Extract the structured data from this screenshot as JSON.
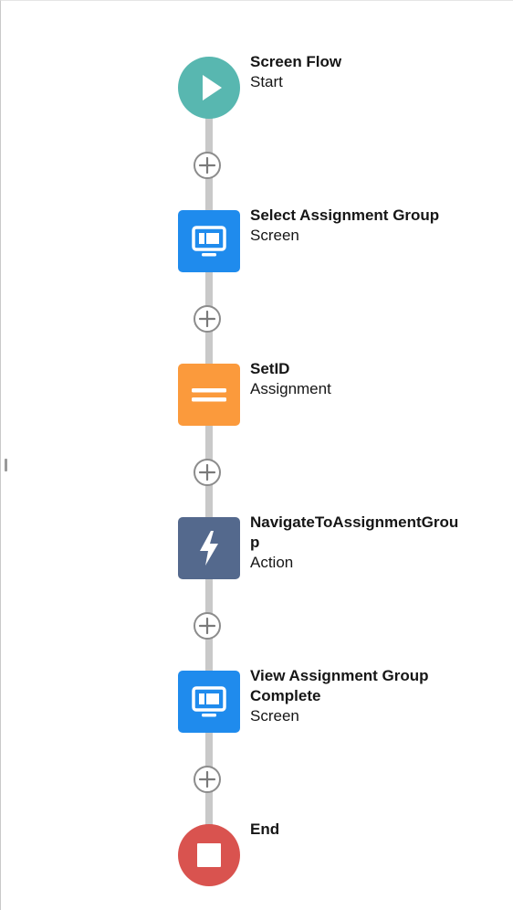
{
  "flow": {
    "elements": [
      {
        "title": "Screen Flow",
        "subtitle": "Start",
        "kind": "start",
        "color": "#58b7b0",
        "icon": "play-icon"
      },
      {
        "title": "Select Assignment Group",
        "subtitle": "Screen",
        "kind": "screen",
        "color": "#1f8bed",
        "icon": "screen-icon"
      },
      {
        "title": "SetID",
        "subtitle": "Assignment",
        "kind": "assignment",
        "color": "#fb9a3c",
        "icon": "equals-icon"
      },
      {
        "title": "NavigateToAssignmentGrou\np",
        "subtitle": "Action",
        "kind": "action",
        "color": "#54698d",
        "icon": "lightning-icon"
      },
      {
        "title": "View Assignment Group\nComplete",
        "subtitle": "Screen",
        "kind": "screen",
        "color": "#1f8bed",
        "icon": "screen-icon"
      },
      {
        "title": "End",
        "subtitle": "",
        "kind": "end",
        "color": "#d9534f",
        "icon": "stop-icon"
      }
    ],
    "add_button_icon": "plus-icon",
    "connector_color": "#c9c9c9"
  }
}
